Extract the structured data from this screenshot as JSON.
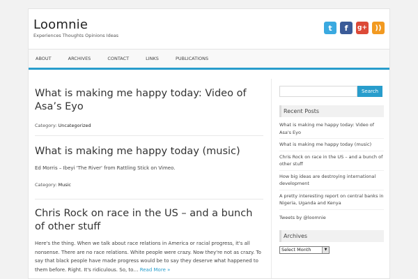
{
  "site": {
    "title": "Loomnie",
    "description": "Experiences Thoughts Opinions Ideas"
  },
  "social": {
    "twitter": {
      "icon": "twitter-icon",
      "glyph": "t",
      "color": "#3aa9e0"
    },
    "facebook": {
      "icon": "facebook-icon",
      "glyph": "f",
      "color": "#3b5b98"
    },
    "googleplus": {
      "icon": "googleplus-icon",
      "glyph": "g+",
      "color": "#dc4a38"
    },
    "rss": {
      "icon": "rss-icon",
      "glyph": "))",
      "color": "#f29a21"
    }
  },
  "nav": {
    "items": [
      "ABOUT",
      "ARCHIVES",
      "CONTACT",
      "LINKS",
      "PUBLICATIONS"
    ]
  },
  "accent_color": "#289dcc",
  "posts": [
    {
      "title": "What is making me happy today: Video of Asa’s Eyo",
      "category_label": "Category:",
      "category": "Uncategorized"
    },
    {
      "title": "What is making me happy today (music)",
      "excerpt": "Ed Morris – Ibeyi 'The River' from Rattling Stick on Vimeo.",
      "category_label": "Category:",
      "category": "Music"
    },
    {
      "title": "Chris Rock on race in the US – and a bunch of other stuff",
      "excerpt": "Here's the thing. When we talk about race relations in America or racial progress, it's all nonsense. There are no race relations. White people were crazy. Now they're not as crazy. To say that black people have made progress would be to say they deserve what happened to them before. Right. It's ridiculous. So, to…",
      "read_more": "Read More »"
    }
  ],
  "sidebar": {
    "search": {
      "placeholder": "",
      "button_label": "Search"
    },
    "recent_posts_title": "Recent Posts",
    "recent_posts": [
      "What is making me happy today: Video of Asa's Eyo",
      "What is making me happy today (music)",
      "Chris Rock on race in the US – and a bunch of other stuff",
      "How big ideas are destroying international development",
      "A pretty interesting report on central banks in Nigeria, Uganda and Kenya"
    ],
    "tweets_link": "Tweets by @loomnie",
    "archives_title": "Archives",
    "archives_select": "Select Month"
  }
}
